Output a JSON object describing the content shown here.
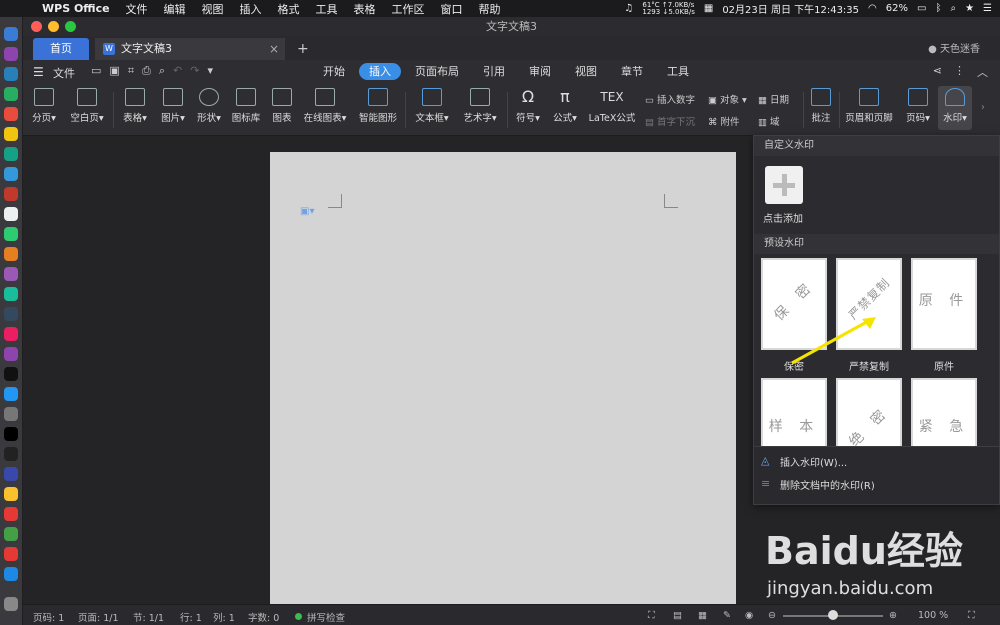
{
  "menubar": {
    "app": "WPS Office",
    "items": [
      "文件",
      "编辑",
      "视图",
      "插入",
      "格式",
      "工具",
      "表格",
      "工作区",
      "窗口",
      "帮助"
    ],
    "cpu_temp": "61°C",
    "fan": "1293",
    "net_up": "↑7.0KB/s",
    "net_down": "↓5.0KB/s",
    "datetime": "02月23日 周日 下午12:43:35",
    "battery": "62%"
  },
  "window": {
    "title": "文字文稿3"
  },
  "tabs": {
    "home": "首页",
    "doc": "文字文稿3",
    "user": "天色迷香"
  },
  "toolbar": {
    "file": "文件",
    "ribbon_tabs": [
      "开始",
      "插入",
      "页面布局",
      "引用",
      "审阅",
      "视图",
      "章节",
      "工具"
    ],
    "active_tab": "插入"
  },
  "ribbon": {
    "page_break": "分页",
    "blank_page": "空白页",
    "table": "表格",
    "picture": "图片",
    "shape": "形状",
    "icon_lib": "图标库",
    "chart": "图表",
    "online_chart": "在线图表",
    "smart_shape": "智能图形",
    "textbox": "文本框",
    "wordart": "艺术字",
    "symbol": "符号",
    "formula": "公式",
    "latex": "LaTeX公式",
    "insert_number": "插入数字",
    "drop_cap": "首字下沉",
    "object": "对象",
    "attachment": "附件",
    "date": "日期",
    "field": "域",
    "comment": "批注",
    "header_footer": "页眉和页脚",
    "page_number": "页码",
    "watermark": "水印"
  },
  "panel": {
    "custom_header": "自定义水印",
    "add_label": "点击添加",
    "preset_header": "预设水印",
    "presets": [
      {
        "text": "保 密",
        "label": "保密"
      },
      {
        "text": "严禁复制",
        "label": "严禁复制"
      },
      {
        "text": "原 件",
        "label": "原件"
      },
      {
        "text": "样 本",
        "label": ""
      },
      {
        "text": "绝 密",
        "label": ""
      },
      {
        "text": "紧 急",
        "label": ""
      }
    ],
    "insert_watermark": "插入水印(W)...",
    "remove_watermark": "删除文档中的水印(R)"
  },
  "status": {
    "page": "页码: 1",
    "pages": "页面: 1/1",
    "section": "节: 1/1",
    "row": "行: 1",
    "col": "列: 1",
    "words": "字数: 0",
    "spell": "拼写检查",
    "zoom": "100 %"
  },
  "baidu": {
    "logo": "Baidu经验",
    "url": "jingyan.baidu.com"
  }
}
